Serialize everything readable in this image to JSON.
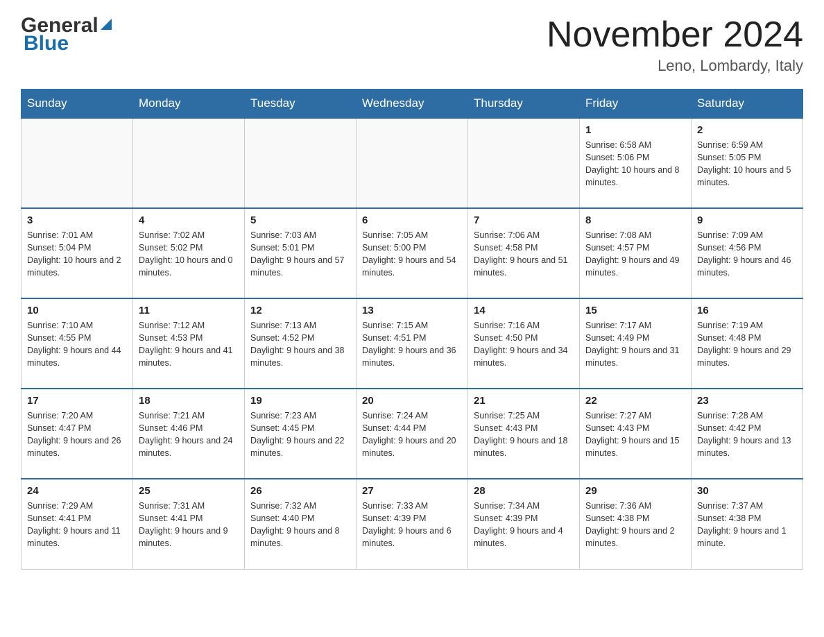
{
  "header": {
    "logo_general": "General",
    "logo_blue": "Blue",
    "title": "November 2024",
    "subtitle": "Leno, Lombardy, Italy"
  },
  "days_of_week": [
    "Sunday",
    "Monday",
    "Tuesday",
    "Wednesday",
    "Thursday",
    "Friday",
    "Saturday"
  ],
  "weeks": [
    [
      {
        "day": "",
        "info": ""
      },
      {
        "day": "",
        "info": ""
      },
      {
        "day": "",
        "info": ""
      },
      {
        "day": "",
        "info": ""
      },
      {
        "day": "",
        "info": ""
      },
      {
        "day": "1",
        "info": "Sunrise: 6:58 AM\nSunset: 5:06 PM\nDaylight: 10 hours and 8 minutes."
      },
      {
        "day": "2",
        "info": "Sunrise: 6:59 AM\nSunset: 5:05 PM\nDaylight: 10 hours and 5 minutes."
      }
    ],
    [
      {
        "day": "3",
        "info": "Sunrise: 7:01 AM\nSunset: 5:04 PM\nDaylight: 10 hours and 2 minutes."
      },
      {
        "day": "4",
        "info": "Sunrise: 7:02 AM\nSunset: 5:02 PM\nDaylight: 10 hours and 0 minutes."
      },
      {
        "day": "5",
        "info": "Sunrise: 7:03 AM\nSunset: 5:01 PM\nDaylight: 9 hours and 57 minutes."
      },
      {
        "day": "6",
        "info": "Sunrise: 7:05 AM\nSunset: 5:00 PM\nDaylight: 9 hours and 54 minutes."
      },
      {
        "day": "7",
        "info": "Sunrise: 7:06 AM\nSunset: 4:58 PM\nDaylight: 9 hours and 51 minutes."
      },
      {
        "day": "8",
        "info": "Sunrise: 7:08 AM\nSunset: 4:57 PM\nDaylight: 9 hours and 49 minutes."
      },
      {
        "day": "9",
        "info": "Sunrise: 7:09 AM\nSunset: 4:56 PM\nDaylight: 9 hours and 46 minutes."
      }
    ],
    [
      {
        "day": "10",
        "info": "Sunrise: 7:10 AM\nSunset: 4:55 PM\nDaylight: 9 hours and 44 minutes."
      },
      {
        "day": "11",
        "info": "Sunrise: 7:12 AM\nSunset: 4:53 PM\nDaylight: 9 hours and 41 minutes."
      },
      {
        "day": "12",
        "info": "Sunrise: 7:13 AM\nSunset: 4:52 PM\nDaylight: 9 hours and 38 minutes."
      },
      {
        "day": "13",
        "info": "Sunrise: 7:15 AM\nSunset: 4:51 PM\nDaylight: 9 hours and 36 minutes."
      },
      {
        "day": "14",
        "info": "Sunrise: 7:16 AM\nSunset: 4:50 PM\nDaylight: 9 hours and 34 minutes."
      },
      {
        "day": "15",
        "info": "Sunrise: 7:17 AM\nSunset: 4:49 PM\nDaylight: 9 hours and 31 minutes."
      },
      {
        "day": "16",
        "info": "Sunrise: 7:19 AM\nSunset: 4:48 PM\nDaylight: 9 hours and 29 minutes."
      }
    ],
    [
      {
        "day": "17",
        "info": "Sunrise: 7:20 AM\nSunset: 4:47 PM\nDaylight: 9 hours and 26 minutes."
      },
      {
        "day": "18",
        "info": "Sunrise: 7:21 AM\nSunset: 4:46 PM\nDaylight: 9 hours and 24 minutes."
      },
      {
        "day": "19",
        "info": "Sunrise: 7:23 AM\nSunset: 4:45 PM\nDaylight: 9 hours and 22 minutes."
      },
      {
        "day": "20",
        "info": "Sunrise: 7:24 AM\nSunset: 4:44 PM\nDaylight: 9 hours and 20 minutes."
      },
      {
        "day": "21",
        "info": "Sunrise: 7:25 AM\nSunset: 4:43 PM\nDaylight: 9 hours and 18 minutes."
      },
      {
        "day": "22",
        "info": "Sunrise: 7:27 AM\nSunset: 4:43 PM\nDaylight: 9 hours and 15 minutes."
      },
      {
        "day": "23",
        "info": "Sunrise: 7:28 AM\nSunset: 4:42 PM\nDaylight: 9 hours and 13 minutes."
      }
    ],
    [
      {
        "day": "24",
        "info": "Sunrise: 7:29 AM\nSunset: 4:41 PM\nDaylight: 9 hours and 11 minutes."
      },
      {
        "day": "25",
        "info": "Sunrise: 7:31 AM\nSunset: 4:41 PM\nDaylight: 9 hours and 9 minutes."
      },
      {
        "day": "26",
        "info": "Sunrise: 7:32 AM\nSunset: 4:40 PM\nDaylight: 9 hours and 8 minutes."
      },
      {
        "day": "27",
        "info": "Sunrise: 7:33 AM\nSunset: 4:39 PM\nDaylight: 9 hours and 6 minutes."
      },
      {
        "day": "28",
        "info": "Sunrise: 7:34 AM\nSunset: 4:39 PM\nDaylight: 9 hours and 4 minutes."
      },
      {
        "day": "29",
        "info": "Sunrise: 7:36 AM\nSunset: 4:38 PM\nDaylight: 9 hours and 2 minutes."
      },
      {
        "day": "30",
        "info": "Sunrise: 7:37 AM\nSunset: 4:38 PM\nDaylight: 9 hours and 1 minute."
      }
    ]
  ]
}
